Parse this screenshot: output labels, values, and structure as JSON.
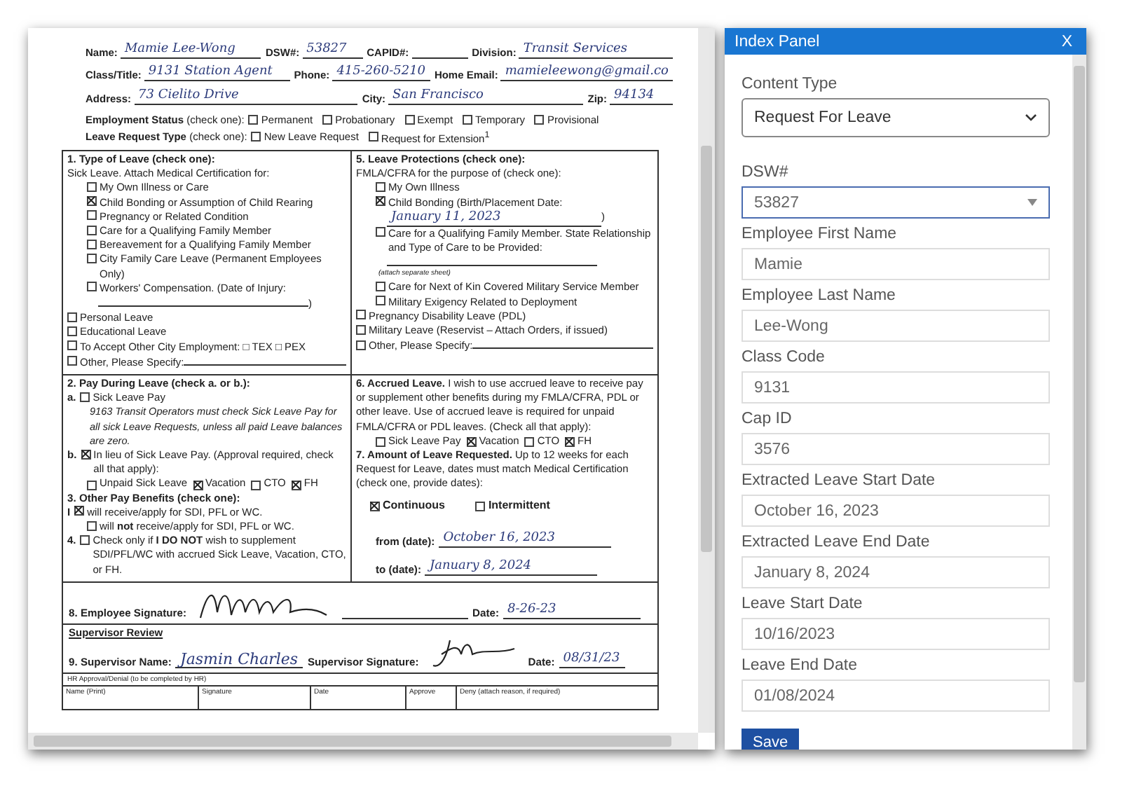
{
  "document": {
    "header_rows": [
      [
        {
          "label": "Name:",
          "value": "Mamie Lee-Wong"
        },
        {
          "label": "DSW#:",
          "value": "53827"
        },
        {
          "label": "CAPID#:"
        },
        {
          "label": "Division:",
          "value": "Transit Services"
        }
      ],
      [
        {
          "label": "Class/Title:",
          "value": "9131 Station Agent"
        },
        {
          "label": "Phone:",
          "value": "415-260-5210"
        },
        {
          "label": "Home Email:",
          "value": "mamieleewong@gmail.co"
        }
      ],
      [
        {
          "label": "Address:",
          "value": "73 Cielito Drive"
        },
        {
          "label": "City:",
          "value": "San Francisco"
        },
        {
          "label": "Zip:",
          "value": "94134"
        }
      ]
    ],
    "choice_rows": [
      {
        "label": "Employment Status",
        "hint": "(check one):",
        "options": [
          {
            "label": "Permanent",
            "checked": false
          },
          {
            "label": "Probationary",
            "checked": false
          },
          {
            "label": "Exempt",
            "checked": false
          },
          {
            "label": "Temporary",
            "checked": false
          },
          {
            "label": "Provisional",
            "checked": false
          }
        ]
      },
      {
        "label": "Leave Request Type",
        "hint": "(check one):",
        "options": [
          {
            "label": "New Leave Request",
            "checked": false
          },
          {
            "label": "Request for Extension$^{1}$",
            "checked": false
          }
        ]
      }
    ],
    "sections": [
      {
        "left": [
          {
            "kind": "heading",
            "text": "1.  Type of Leave (check one):"
          },
          {
            "kind": "text",
            "text": "Sick Leave. Attach Medical Certification for:"
          },
          {
            "kind": "sub_option",
            "text": "My Own Illness or Care",
            "checked": false
          },
          {
            "kind": "sub_option",
            "text": "Child Bonding or Assumption of Child Rearing",
            "checked": true
          },
          {
            "kind": "sub_option",
            "text": "Pregnancy or Related Condition",
            "checked": false
          },
          {
            "kind": "sub_option",
            "text": "Care for a Qualifying Family Member",
            "checked": false
          },
          {
            "kind": "sub_option",
            "text": "Bereavement for a Qualifying Family Member",
            "checked": false
          },
          {
            "kind": "sub_option",
            "text": "City Family Care Leave (Permanent Employees Only)",
            "checked": false
          },
          {
            "kind": "sub_option",
            "text": "Workers' Compensation. (Date of Injury:",
            "checked": false
          },
          {
            "kind": "blank_line",
            "text": ")"
          },
          {
            "kind": "option",
            "text": "Personal Leave",
            "checked": false
          },
          {
            "kind": "option",
            "text": "Educational Leave",
            "checked": false
          },
          {
            "kind": "option",
            "text": "To Accept Other City Employment: □ TEX □ PEX",
            "checked": false
          },
          {
            "kind": "option",
            "text": "Other, Please Specify:",
            "checked": false,
            "blank": true
          }
        ],
        "right": [
          {
            "kind": "heading",
            "text": "5. Leave Protections (check one):"
          },
          {
            "kind": "text",
            "text": "FMLA/CFRA for the purpose of (check one):"
          },
          {
            "kind": "sub_option",
            "text": "My Own Illness",
            "checked": false
          },
          {
            "kind": "sub_option",
            "text": "Child Bonding (Birth/Placement Date:",
            "checked": true
          },
          {
            "kind": "handwritten_line",
            "value": "January 11, 2023",
            "text": ")"
          },
          {
            "kind": "sub_option",
            "text": "Care for a Qualifying Family Member. State Relationship and Type of Care to be Provided:",
            "checked": false
          },
          {
            "kind": "blank_line"
          },
          {
            "kind": "note",
            "text": "(attach separate sheet)"
          },
          {
            "kind": "sub_option",
            "text": "Care for Next of Kin Covered Military Service Member",
            "checked": false
          },
          {
            "kind": "sub_option",
            "text": "Military Exigency Related to Deployment",
            "checked": false
          },
          {
            "kind": "option",
            "text": "Pregnancy Disability Leave (PDL)",
            "checked": false
          },
          {
            "kind": "option",
            "text": "Military Leave (Reservist – Attach Orders, if issued)",
            "checked": false
          },
          {
            "kind": "option",
            "text": "Other, Please Specify:",
            "checked": false,
            "blank": true
          }
        ]
      },
      {
        "left": [
          {
            "kind": "heading",
            "text": "2.  Pay During Leave (check a. or b.):"
          },
          {
            "kind": "option",
            "marker": "a.",
            "text": "Sick Leave Pay",
            "checked": false
          },
          {
            "kind": "note",
            "text": "9163 Transit Operators must check Sick Leave Pay for all sick Leave Requests, unless all paid Leave balances are zero."
          },
          {
            "kind": "option",
            "marker": "b.",
            "text": "In lieu of Sick Leave Pay. (Approval required, check all that apply):",
            "checked": true
          },
          {
            "kind": "checks",
            "items": [
              {
                "label": "Unpaid Sick Leave",
                "checked": false
              },
              {
                "label": "Vacation",
                "checked": true
              },
              {
                "label": "CTO",
                "checked": false
              },
              {
                "label": "FH",
                "checked": true
              }
            ]
          },
          {
            "kind": "heading",
            "text": "3.  Other Pay Benefits (check one):"
          },
          {
            "kind": "option",
            "marker": "I",
            "text": "will receive/apply for SDI, PFL or WC.",
            "checked": true
          },
          {
            "kind": "sub_option",
            "text": "will **not** receive/apply for SDI, PFL or WC.",
            "checked": false
          },
          {
            "kind": "option",
            "marker": "4.",
            "text": "Check only if **I DO NOT** wish to supplement SDI/PFL/WC with accrued Sick Leave, Vacation, CTO, or FH.",
            "checked": false
          }
        ],
        "right": [
          {
            "kind": "text",
            "text": "**6. Accrued Leave.** I wish to use accrued leave to receive pay or supplement other benefits during my FMLA/CFRA, PDL or other leave. Use of accrued leave is required for unpaid FMLA/CFRA or PDL leaves. (Check all that apply):"
          },
          {
            "kind": "checks",
            "items": [
              {
                "label": "Sick Leave Pay",
                "checked": false
              },
              {
                "label": "Vacation",
                "checked": true
              },
              {
                "label": "CTO",
                "checked": false
              },
              {
                "label": "FH",
                "checked": true
              }
            ]
          },
          {
            "kind": "text",
            "text": "**7. Amount of Leave Requested.** Up to 12 weeks for each Request for Leave, dates must match Medical Certification (check one, provide dates):"
          },
          {
            "kind": "checks",
            "emphasis": true,
            "items": [
              {
                "label": "Continuous",
                "checked": true
              },
              {
                "label": "Intermittent",
                "checked": false
              }
            ]
          },
          {
            "kind": "date_line",
            "text": "from (date):",
            "value": "October 16, 2023"
          },
          {
            "kind": "date_line",
            "text": "to (date):",
            "value": "January 8, 2024"
          }
        ]
      }
    ],
    "employee_signature": {
      "label": "8. Employee Signature:",
      "date_label": "Date:",
      "date": "8-26-23"
    },
    "supervisor": {
      "title": "Supervisor Review",
      "name_label": "9. Supervisor Name:",
      "name": "Jasmin Charles",
      "signature_label": "Supervisor Signature:",
      "date_label": "Date:",
      "date": "08/31/23"
    },
    "hr": {
      "title": "HR Approval/Denial (to be completed by HR)",
      "columns": [
        "Name (Print)",
        "Signature",
        "Date",
        "Approve",
        "Deny (attach reason, if required)"
      ]
    }
  },
  "panel": {
    "title": "Index Panel",
    "close": "X",
    "fields": [
      {
        "label": "Content Type",
        "kind": "select",
        "value": "Request For Leave",
        "focused": false
      },
      {
        "label": "DSW#",
        "kind": "combo",
        "value": "53827",
        "focused": true
      },
      {
        "label": "Employee First Name",
        "kind": "text",
        "value": "Mamie",
        "focused": false
      },
      {
        "label": "Employee Last Name",
        "kind": "text",
        "value": "Lee-Wong",
        "focused": false
      },
      {
        "label": "Class Code",
        "kind": "text",
        "value": "9131",
        "focused": false
      },
      {
        "label": "Cap ID",
        "kind": "text",
        "value": "3576",
        "focused": false
      },
      {
        "label": "Extracted Leave Start Date",
        "kind": "text",
        "value": "October 16, 2023",
        "focused": false
      },
      {
        "label": "Extracted Leave End Date",
        "kind": "text",
        "value": "January 8, 2024",
        "focused": false
      },
      {
        "label": "Leave Start Date",
        "kind": "text",
        "value": "10/16/2023",
        "focused": false
      },
      {
        "label": "Leave End Date",
        "kind": "text",
        "value": "01/08/2024",
        "focused": false
      }
    ],
    "save": "Save"
  }
}
